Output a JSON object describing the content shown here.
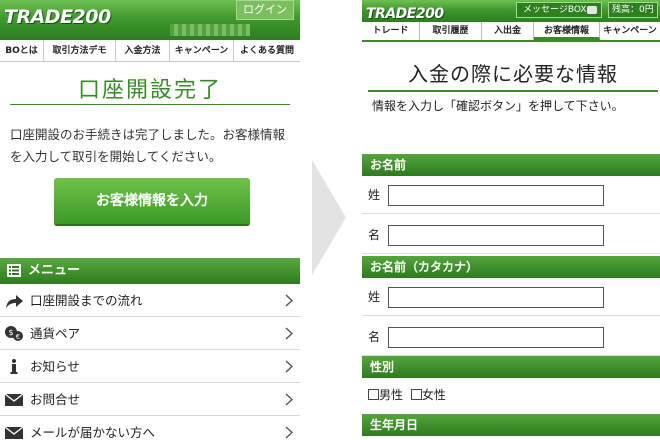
{
  "left": {
    "logo": "TRADE200",
    "login": "ログイン",
    "nav": [
      "BOとは",
      "取引方法デモ",
      "入金方法",
      "キャンペーン",
      "よくある質問"
    ],
    "title": "口座開設完了",
    "message": "口座開設のお手続きは完了しました。お客様情報を入力して取引を開始してください。",
    "cta": "お客様情報を入力",
    "menu_header": "メニュー",
    "menu": [
      {
        "label": "口座開設までの流れ",
        "icon": "share-arrow-icon"
      },
      {
        "label": "通貨ペア",
        "icon": "currency-icon"
      },
      {
        "label": "お知らせ",
        "icon": "info-icon"
      },
      {
        "label": "お問合せ",
        "icon": "mail-icon"
      },
      {
        "label": "メールが届かない方へ",
        "icon": "mail-icon"
      }
    ]
  },
  "right": {
    "logo": "TRADE200",
    "message_box": "メッセージBOX",
    "balance": "残高：0円",
    "nav": [
      "トレード",
      "取引履歴",
      "入出金",
      "お客様情報",
      "キャンペーン"
    ],
    "active_tab": "お客様情報",
    "title": "入金の際に必要な情報",
    "instruction": "情報を入力し「確認ボタン」を押して下さい。",
    "sections": {
      "name": "お名前",
      "kana": "お名前（カタカナ）",
      "gender": "性別",
      "birth": "生年月日"
    },
    "surname": "姓",
    "given": "名",
    "male": "男性",
    "female": "女性"
  },
  "colors": {
    "brand_green": "#3a8a2b",
    "cta_green": "#4fae33"
  }
}
